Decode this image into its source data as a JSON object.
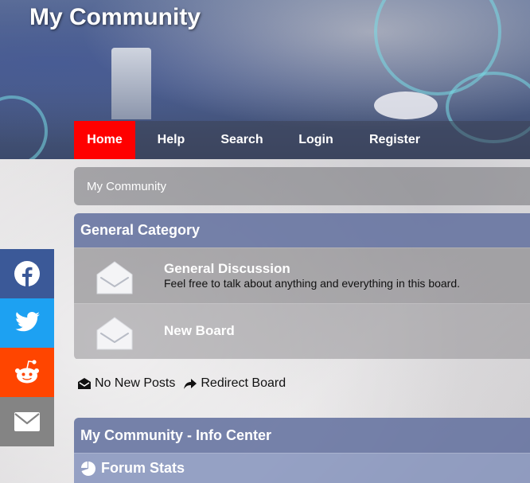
{
  "site": {
    "title": "My Community"
  },
  "nav": {
    "items": [
      {
        "label": "Home",
        "active": true
      },
      {
        "label": "Help"
      },
      {
        "label": "Search"
      },
      {
        "label": "Login"
      },
      {
        "label": "Register"
      }
    ],
    "active_color": "#ff0000"
  },
  "breadcrumb": {
    "text": "My Community"
  },
  "category": {
    "title": "General Category",
    "boards": [
      {
        "name": "General Discussion",
        "description": "Feel free to talk about anything and everything in this board.",
        "icon": "envelope-open-icon"
      },
      {
        "name": "New Board",
        "description": "",
        "icon": "envelope-open-icon"
      }
    ]
  },
  "legend": {
    "no_new_posts": "No New Posts",
    "redirect_board": "Redirect Board"
  },
  "info_center": {
    "title": "My Community - Info Center",
    "forum_stats": "Forum Stats"
  },
  "share": {
    "buttons": [
      {
        "name": "facebook",
        "color": "#3b5998"
      },
      {
        "name": "twitter",
        "color": "#1da1f2"
      },
      {
        "name": "reddit",
        "color": "#ff4500"
      },
      {
        "name": "email",
        "color": "#848484"
      }
    ]
  }
}
